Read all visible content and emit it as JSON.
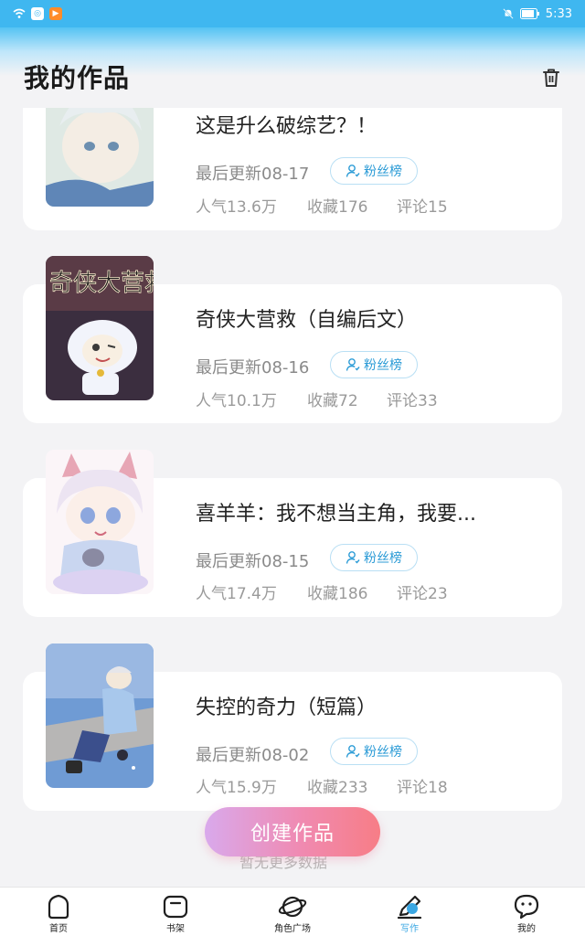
{
  "status_bar": {
    "time": "5:33",
    "battery_icon": "battery-icon",
    "mute_icon": "bell-muted-icon",
    "wifi_icon": "wifi-icon"
  },
  "header": {
    "title": "我的作品",
    "delete_icon": "trash-icon"
  },
  "works": [
    {
      "title": "这是升么破综艺？！",
      "updated": "最后更新08-17",
      "fans_label": "粉丝榜",
      "popularity": "人气13.6万",
      "favorites": "收藏176",
      "comments": "评论15"
    },
    {
      "title": "奇侠大营救（自编后文）",
      "cover_text": "奇侠大营救",
      "updated": "最后更新08-16",
      "fans_label": "粉丝榜",
      "popularity": "人气10.1万",
      "favorites": "收藏72",
      "comments": "评论33"
    },
    {
      "title": "喜羊羊：我不想当主角，我要...",
      "updated": "最后更新08-15",
      "fans_label": "粉丝榜",
      "popularity": "人气17.4万",
      "favorites": "收藏186",
      "comments": "评论23"
    },
    {
      "title": "失控的奇力（短篇）",
      "updated": "最后更新08-02",
      "fans_label": "粉丝榜",
      "popularity": "人气15.9万",
      "favorites": "收藏233",
      "comments": "评论18"
    }
  ],
  "create_button": "创建作品",
  "load_more": "暂无更多数据",
  "bottom_nav": [
    {
      "label": "首页",
      "icon": "home-icon"
    },
    {
      "label": "书架",
      "icon": "bookshelf-icon"
    },
    {
      "label": "角色广场",
      "icon": "planet-icon"
    },
    {
      "label": "写作",
      "icon": "pen-icon",
      "active": true
    },
    {
      "label": "我的",
      "icon": "chat-face-icon"
    }
  ],
  "colors": {
    "accent": "#3aa7e3",
    "status_bar": "#3fb7f0",
    "create_gradient_start": "#d9a9ec",
    "create_gradient_end": "#f77d86"
  }
}
